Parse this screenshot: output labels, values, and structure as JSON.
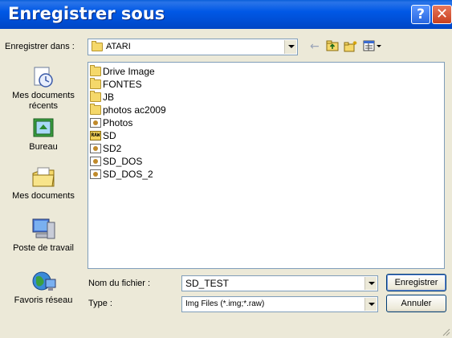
{
  "title_bar": {
    "title": "Enregistrer sous",
    "help_glyph": "?",
    "close_glyph": "✕",
    "color": "#0058e6"
  },
  "save_in": {
    "label": "Enregistrer dans :",
    "value": "ATARI"
  },
  "toolbar": {
    "back_icon": "←",
    "up_icon": "up-folder-icon",
    "new_folder_icon": "new-folder-icon",
    "view_menu_icon": "view-menu-icon"
  },
  "places": [
    {
      "label": "Mes documents récents",
      "icon": "recent-documents-icon"
    },
    {
      "label": "Bureau",
      "icon": "desktop-icon"
    },
    {
      "label": "Mes documents",
      "icon": "my-documents-icon"
    },
    {
      "label": "Poste de travail",
      "icon": "my-computer-icon"
    },
    {
      "label": "Favoris réseau",
      "icon": "network-places-icon"
    }
  ],
  "files": [
    {
      "name": "Drive Image",
      "type": "folder"
    },
    {
      "name": "FONTES",
      "type": "folder"
    },
    {
      "name": "JB",
      "type": "folder"
    },
    {
      "name": "photos ac2009",
      "type": "folder"
    },
    {
      "name": "Photos",
      "type": "img"
    },
    {
      "name": "SD",
      "type": "raw"
    },
    {
      "name": "SD2",
      "type": "img"
    },
    {
      "name": "SD_DOS",
      "type": "img"
    },
    {
      "name": "SD_DOS_2",
      "type": "img"
    }
  ],
  "raw_badge": "RAW",
  "filename": {
    "label": "Nom du fichier :",
    "value": "SD_TEST"
  },
  "filetype": {
    "label": "Type :",
    "value": "Img Files (*.img;*.raw)"
  },
  "buttons": {
    "save": "Enregistrer",
    "cancel": "Annuler"
  }
}
